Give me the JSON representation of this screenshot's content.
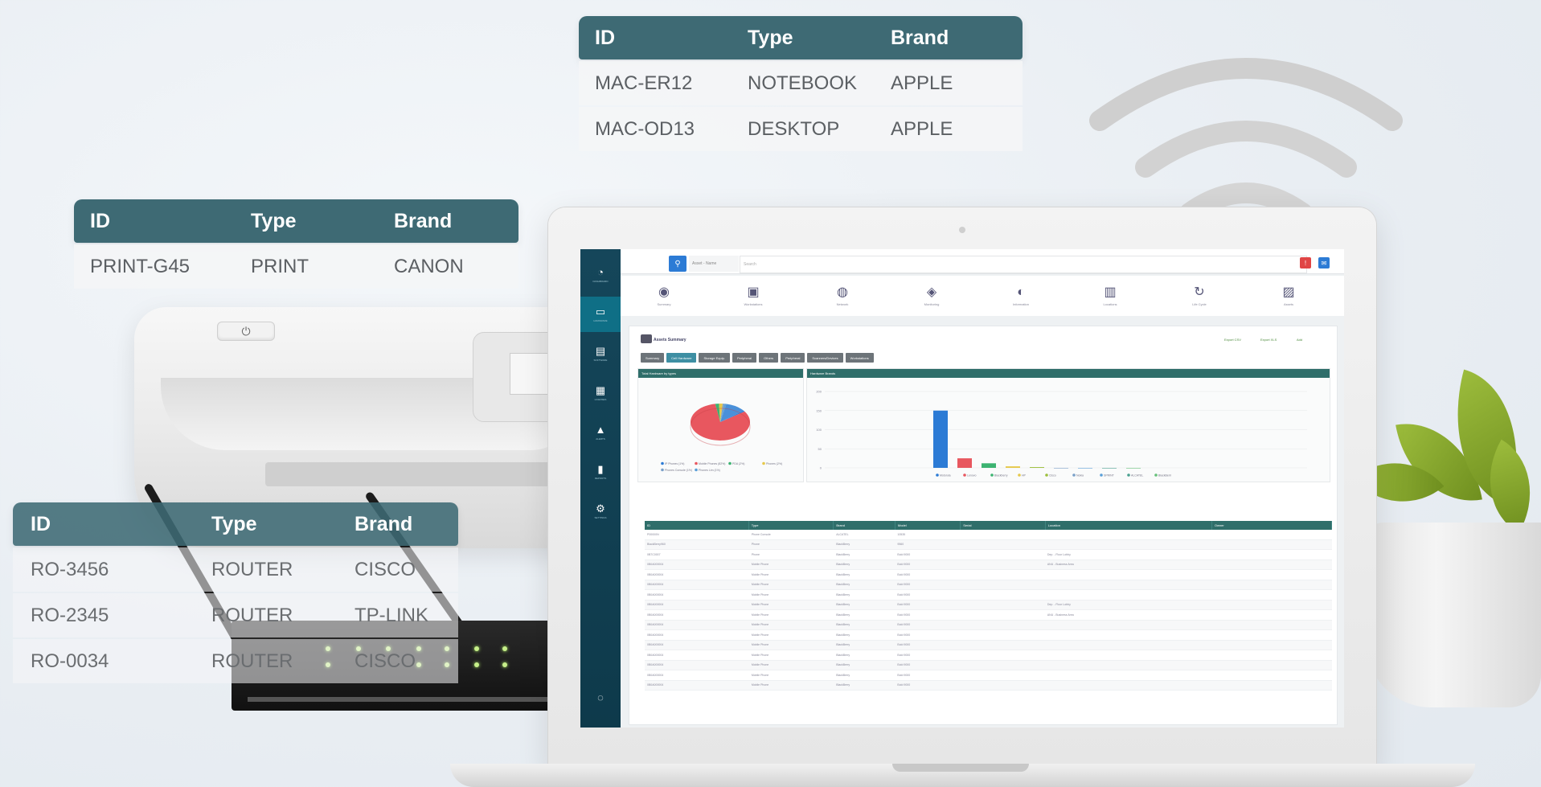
{
  "tables": {
    "top": {
      "headers": [
        "ID",
        "Type",
        "Brand"
      ],
      "rows": [
        [
          "MAC-ER12",
          "NOTEBOOK",
          "APPLE"
        ],
        [
          "MAC-OD13",
          "DESKTOP",
          "APPLE"
        ]
      ]
    },
    "printer": {
      "headers": [
        "ID",
        "Type",
        "Brand"
      ],
      "rows": [
        [
          "PRINT-G45",
          "PRINT",
          "CANON"
        ]
      ]
    },
    "router": {
      "headers": [
        "ID",
        "Type",
        "Brand"
      ],
      "rows": [
        [
          "RO-3456",
          "ROUTER",
          "CISCO"
        ],
        [
          "RO-2345",
          "ROUTER",
          "TP-LINK"
        ],
        [
          "RO-0034",
          "ROUTER",
          "CISCO"
        ]
      ]
    }
  },
  "printer_device": {
    "power_glyph": "⏻"
  },
  "app": {
    "search": {
      "scope": "Asset - Name",
      "placeholder": "Search"
    },
    "sidebar": [
      {
        "icon": "dashboard-icon",
        "glyph": "◔",
        "label": "DASHBOARD"
      },
      {
        "icon": "hardware-icon",
        "glyph": "▭",
        "label": "HARDWARE"
      },
      {
        "icon": "software-icon",
        "glyph": "▤",
        "label": "SOFTWARE"
      },
      {
        "icon": "licenses-icon",
        "glyph": "▦",
        "label": "LICENSES"
      },
      {
        "icon": "alerts-icon",
        "glyph": "▲",
        "label": "ALERTS"
      },
      {
        "icon": "reports-icon",
        "glyph": "▮",
        "label": "REPORTS"
      },
      {
        "icon": "settings-icon",
        "glyph": "⚙",
        "label": "SETTINGS"
      }
    ],
    "categories": [
      {
        "icon": "summary-icon",
        "glyph": "◉",
        "label": "Summary"
      },
      {
        "icon": "workstations-icon",
        "glyph": "▣",
        "label": "Workstations"
      },
      {
        "icon": "network-icon",
        "glyph": "◍",
        "label": "Network"
      },
      {
        "icon": "monitoring-icon",
        "glyph": "◈",
        "label": "Monitoring"
      },
      {
        "icon": "information-icon",
        "glyph": "◐",
        "label": "Information"
      },
      {
        "icon": "locations-icon",
        "glyph": "▥",
        "label": "Locations"
      },
      {
        "icon": "lifecycle-icon",
        "glyph": "↻",
        "label": "Life Cycle"
      },
      {
        "icon": "assets-icon",
        "glyph": "▨",
        "label": "Assets"
      }
    ],
    "panel_title": "Assets Summary",
    "export_buttons": [
      "Export CSV",
      "Export XLS",
      "Add"
    ],
    "tabs": [
      "Summary",
      "Cell Hardware",
      "Storage Equip.",
      "Peripheral",
      "Others",
      "Peripheral",
      "Scanners/Devices",
      "Workstations"
    ],
    "active_tab": 1,
    "pie_card_title": "Total Hardware by types",
    "bar_card_title": "Hardware Brands",
    "grid_columns": [
      "ID",
      "Type",
      "Brand",
      "Model",
      "Serial",
      "Location",
      "Owner"
    ]
  },
  "chart_data": [
    {
      "type": "pie",
      "title": "Total Hardware by types",
      "slices": [
        {
          "label": "IP Phones (1%)",
          "value": 1,
          "color": "#2c7bd5"
        },
        {
          "label": "Mobile Phones (82%)",
          "value": 82,
          "color": "#e8575f"
        },
        {
          "label": "PDA (2%)",
          "value": 2,
          "color": "#3cb371"
        },
        {
          "label": "Phones (2%)",
          "value": 2,
          "color": "#e6c84a"
        },
        {
          "label": "Phones Console (1%)",
          "value": 1,
          "color": "#7aa0c8"
        },
        {
          "label": "Phones Lim (1%)",
          "value": 1,
          "color": "#5a9fd8"
        },
        {
          "label": "Other",
          "value": 11,
          "color": "#4a90d9"
        }
      ],
      "legend": [
        "IP Phones (1%)",
        "Mobile Phones (82%)",
        "PDA (2%)",
        "Phones (2%)",
        "Phones Console (1%)",
        "Phones Lim (1%)"
      ]
    },
    {
      "type": "bar",
      "title": "Hardware Brands",
      "categories": [
        "Motorola",
        "Lenovo",
        "Blackberry",
        "HP",
        "Cisco",
        "Nokia",
        "SPRINT",
        "ALCATEL",
        "BlackBerri"
      ],
      "values": [
        150,
        25,
        12,
        4,
        2,
        0,
        0,
        0,
        0
      ],
      "colors": [
        "#2c7bd5",
        "#e8575f",
        "#3cb371",
        "#e6c84a",
        "#9cbf3c",
        "#7aa0c8",
        "#5a9fd8",
        "#4aa090",
        "#66c07a"
      ],
      "yticks": [
        "200",
        "150",
        "100",
        "50",
        "0"
      ],
      "ylim": [
        0,
        200
      ]
    }
  ],
  "grid_rows": [
    [
      "P00000N",
      "Phone Console",
      "ALCATEL",
      "10535",
      "",
      "",
      ""
    ],
    [
      "BlackBerry960",
      "Phone",
      "BlackBerry",
      "9560",
      "",
      "",
      ""
    ],
    [
      "0B7C0007",
      "Phone",
      "BlackBerry",
      "Bold 9000",
      "",
      "Dep. - Floor Lobby",
      ""
    ],
    [
      "0B0A000004",
      "Mobile Phone",
      "BlackBerry",
      "Bold 9000",
      "",
      "ANU - Business Area",
      ""
    ],
    [
      "0B0A000004",
      "Mobile Phone",
      "BlackBerry",
      "Bold 9000",
      "",
      "",
      ""
    ],
    [
      "0B0A000004",
      "Mobile Phone",
      "BlackBerry",
      "Bold 9000",
      "",
      "",
      ""
    ],
    [
      "0B0A000004",
      "Mobile Phone",
      "BlackBerry",
      "Bold 9000",
      "",
      "",
      ""
    ],
    [
      "0B0A000004",
      "Mobile Phone",
      "BlackBerry",
      "Bold 9000",
      "",
      "Dep. - Floor Lobby",
      ""
    ],
    [
      "0B0A000004",
      "Mobile Phone",
      "BlackBerry",
      "Bold 9000",
      "",
      "ANU - Business Area",
      ""
    ],
    [
      "0B0A000004",
      "Mobile Phone",
      "BlackBerry",
      "Bold 9000",
      "",
      "",
      ""
    ],
    [
      "0B0A000004",
      "Mobile Phone",
      "BlackBerry",
      "Bold 9000",
      "",
      "",
      ""
    ],
    [
      "0B0A000004",
      "Mobile Phone",
      "BlackBerry",
      "Bold 9000",
      "",
      "",
      ""
    ],
    [
      "0B0A000004",
      "Mobile Phone",
      "BlackBerry",
      "Bold 9000",
      "",
      "",
      ""
    ],
    [
      "0B0A000004",
      "Mobile Phone",
      "BlackBerry",
      "Bold 9000",
      "",
      "",
      ""
    ],
    [
      "0B0A000004",
      "Mobile Phone",
      "BlackBerry",
      "Bold 9000",
      "",
      "",
      ""
    ],
    [
      "0B0A000004",
      "Mobile Phone",
      "BlackBerry",
      "Bold 9000",
      "",
      "",
      ""
    ]
  ]
}
